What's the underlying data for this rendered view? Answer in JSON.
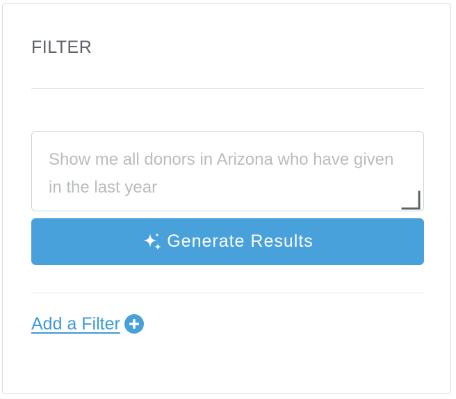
{
  "filter_panel": {
    "title": "FILTER",
    "query_placeholder": "Show me all donors in Arizona who have given in the last year",
    "query_value": "",
    "generate_button_label": "Generate Results",
    "add_filter_label": "Add a Filter "
  },
  "icons": {
    "generate": "sparkle-icon",
    "add_filter": "plus-circle-icon"
  },
  "colors": {
    "accent": "#48a1db",
    "link": "#3f9ad6",
    "title": "#5b6066",
    "placeholder": "#b9bcbf"
  }
}
